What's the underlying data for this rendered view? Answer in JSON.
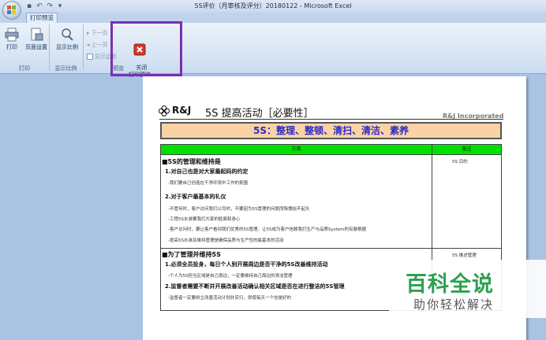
{
  "window": {
    "title": "5S评价（月审核及评分）20180122 - Microsoft Excel"
  },
  "ribbon": {
    "active_tab": "打印预览",
    "buttons": {
      "print": "打印",
      "page_setup": "页面设置",
      "zoom": "显示比例",
      "next_page": "下一页",
      "prev_page": "上一页",
      "show_margins": "显示边距",
      "close_preview": "关闭\n打印预览"
    },
    "groups": {
      "print": "打印",
      "zoom": "显示比例",
      "preview": "预览"
    }
  },
  "page": {
    "logo": "R&J",
    "title": "5S 提高活动［必要性］",
    "corp": "R&J Incorporated",
    "banner": "5S：整理、整顿、清扫、清洁、素养",
    "table_headers": {
      "plan": "方案",
      "note": "备注"
    },
    "section1": {
      "heading": "■5S的管理和维持是",
      "note": "5S 目的",
      "item1": {
        "title": "1.对自己也是对大家最起码的约定",
        "lines": [
          "-我们要自己创造在干净环境中工作的氛围"
        ]
      },
      "item2": {
        "title": "2.对于客户最基本的礼仪",
        "lines": [
          "-不管何时，客户访问我们公司时，不要因为5S管理的问题而惭愧抬不起头",
          "-工程5S水准要我们大家的脸面和身心",
          "-客户访问时，要让客户看到我们优秀的5S管理，让5S成为客户信赖我们生产与品质System的有展根据",
          "-提高5S水准及维持管理是确保品质与生产性的最基本的活动"
        ]
      }
    },
    "section2": {
      "heading": "■为了管理并维持5S",
      "note": "5S 推进管理",
      "item1": {
        "title": "1.必须全员投身，每日个人别开展周边是否干净的5S改善维持活动",
        "lines": [
          "-个人为5S担当区域是自己周边，一定要维持自己周边的清洁管理"
        ]
      },
      "item2": {
        "title": "2.监督者需要不断并开展改善活动确认相关区域是否在进行整洁的5S管理",
        "lines": [
          "-监督者一定要树立改善活动计划并实行，即使每天一个也是好的"
        ]
      }
    }
  },
  "watermark": {
    "main": "百科全说",
    "sub": "助你轻松解决"
  },
  "colors": {
    "highlight": "#7b2fb2",
    "header_green": "#00e000",
    "banner_bg": "#fbd2a4",
    "banner_text": "#2a2cc8"
  }
}
